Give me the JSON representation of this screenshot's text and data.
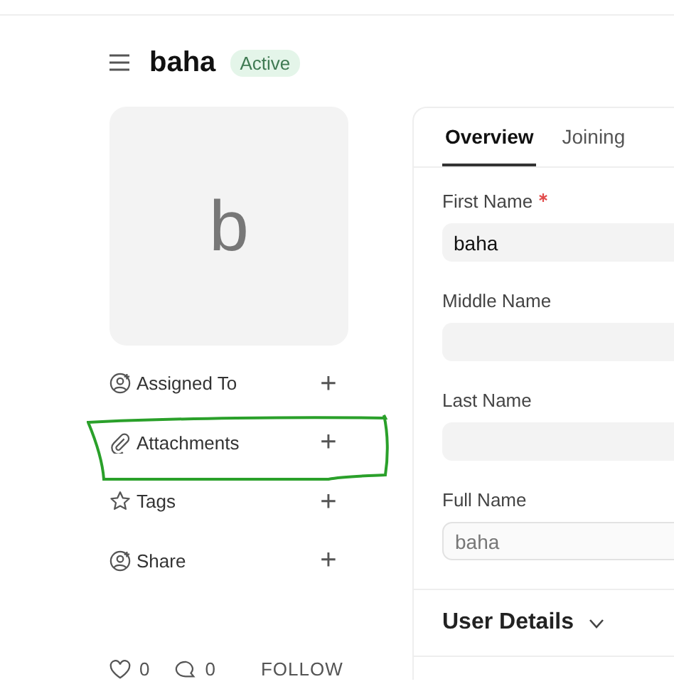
{
  "header": {
    "title": "baha",
    "status": "Active"
  },
  "avatar": {
    "initial": "b"
  },
  "sidebar": {
    "items": [
      {
        "kind": "assign",
        "label": "Assigned To",
        "action": "+"
      },
      {
        "kind": "attach",
        "label": "Attachments",
        "action": "+"
      },
      {
        "kind": "tag",
        "label": "Tags",
        "action": "+"
      },
      {
        "kind": "share",
        "label": "Share",
        "action": "+"
      }
    ]
  },
  "footer": {
    "likes": "0",
    "comments": "0",
    "follow": "FOLLOW"
  },
  "tabs": [
    {
      "label": "Overview",
      "selected": true
    },
    {
      "label": "Joining",
      "selected": false
    }
  ],
  "fields": [
    {
      "label": "First Name",
      "required": true,
      "value": "baha",
      "read_only": false
    },
    {
      "label": "Middle Name",
      "required": false,
      "read_only": false
    },
    {
      "label": "Last Name",
      "required": false,
      "read_only": false
    },
    {
      "label": "Full Name",
      "required": false,
      "value": "baha",
      "read_only": true
    }
  ],
  "section": {
    "title": "User Details",
    "expanded": false
  }
}
